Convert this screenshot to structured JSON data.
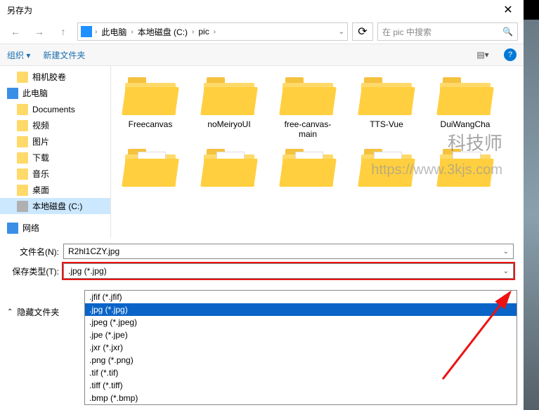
{
  "title": "另存为",
  "nav": {
    "path": [
      "此电脑",
      "本地磁盘 (C:)",
      "pic"
    ],
    "search_placeholder": "在 pic 中搜索"
  },
  "toolbar": {
    "organize": "组织 ▾",
    "newfolder": "新建文件夹"
  },
  "sidebar": {
    "items": [
      {
        "label": "相机胶卷",
        "icon": "folder"
      },
      {
        "label": "此电脑",
        "icon": "pc",
        "root": true
      },
      {
        "label": "Documents",
        "icon": "folder"
      },
      {
        "label": "视频",
        "icon": "folder"
      },
      {
        "label": "图片",
        "icon": "folder"
      },
      {
        "label": "下载",
        "icon": "folder"
      },
      {
        "label": "音乐",
        "icon": "folder"
      },
      {
        "label": "桌面",
        "icon": "folder"
      },
      {
        "label": "本地磁盘 (C:)",
        "icon": "disk",
        "selected": true
      },
      {
        "label": "网络",
        "icon": "net",
        "root": true
      }
    ]
  },
  "folders": {
    "row1": [
      "Freecanvas",
      "noMeiryoUI",
      "free-canvas-main",
      "TTS-Vue",
      "DuiWangCha"
    ],
    "row2": [
      "",
      "",
      "",
      "",
      ""
    ]
  },
  "watermark": {
    "line1": "科技师",
    "line2": "https://www.3kjs.com"
  },
  "fields": {
    "filename_label": "文件名(N):",
    "filename_value": "R2hl1CZY.jpg",
    "type_label": "保存类型(T):",
    "type_value": ".jpg (*.jpg)"
  },
  "dropdown": {
    "options": [
      ".jfif (*.jfif)",
      ".jpg (*.jpg)",
      ".jpeg (*.jpeg)",
      ".jpe (*.jpe)",
      ".jxr (*.jxr)",
      ".png (*.png)",
      ".tif (*.tif)",
      ".tiff (*.tiff)",
      ".bmp (*.bmp)"
    ],
    "selected_index": 1
  },
  "footer": {
    "hide": "隐藏文件夹"
  }
}
